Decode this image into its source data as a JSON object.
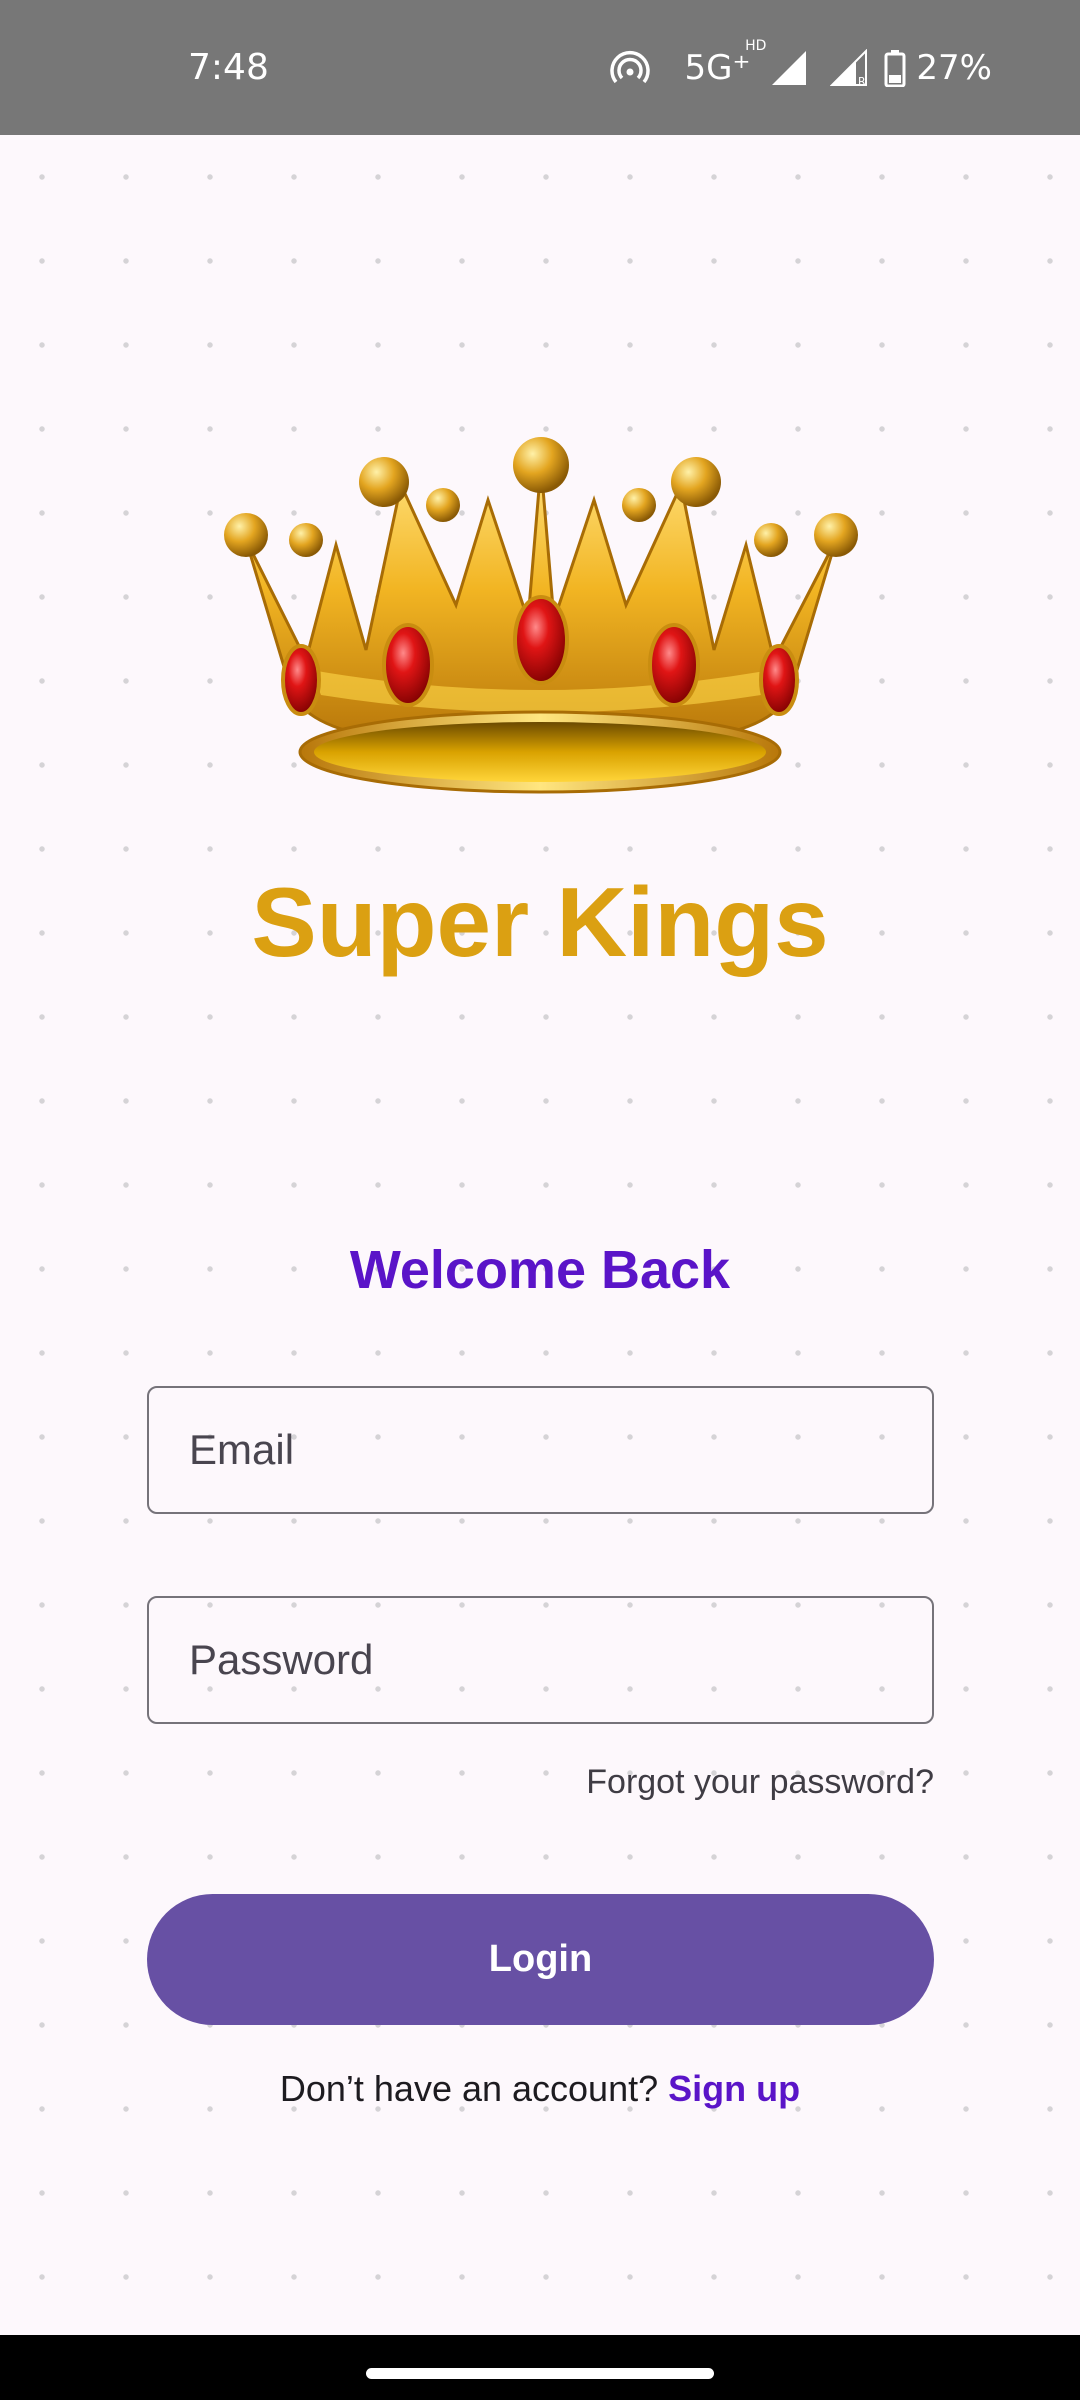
{
  "status_bar": {
    "time": "7:48",
    "network": "5G⁺",
    "network_hd": "HD",
    "battery": "27%",
    "icons": [
      "hotspot-icon",
      "signal-icon",
      "roaming-signal-icon",
      "battery-icon"
    ]
  },
  "app": {
    "title": "Super Kings",
    "logo": "crown-icon",
    "title_color": "#dba012"
  },
  "login": {
    "heading": "Welcome Back",
    "heading_color": "#5a14c8",
    "email_placeholder": "Email",
    "password_placeholder": "Password",
    "forgot_label": "Forgot your password?",
    "login_label": "Login",
    "login_color": "#6750a4",
    "signup_prompt": "Don’t have an account?",
    "signup_link": "Sign up"
  }
}
